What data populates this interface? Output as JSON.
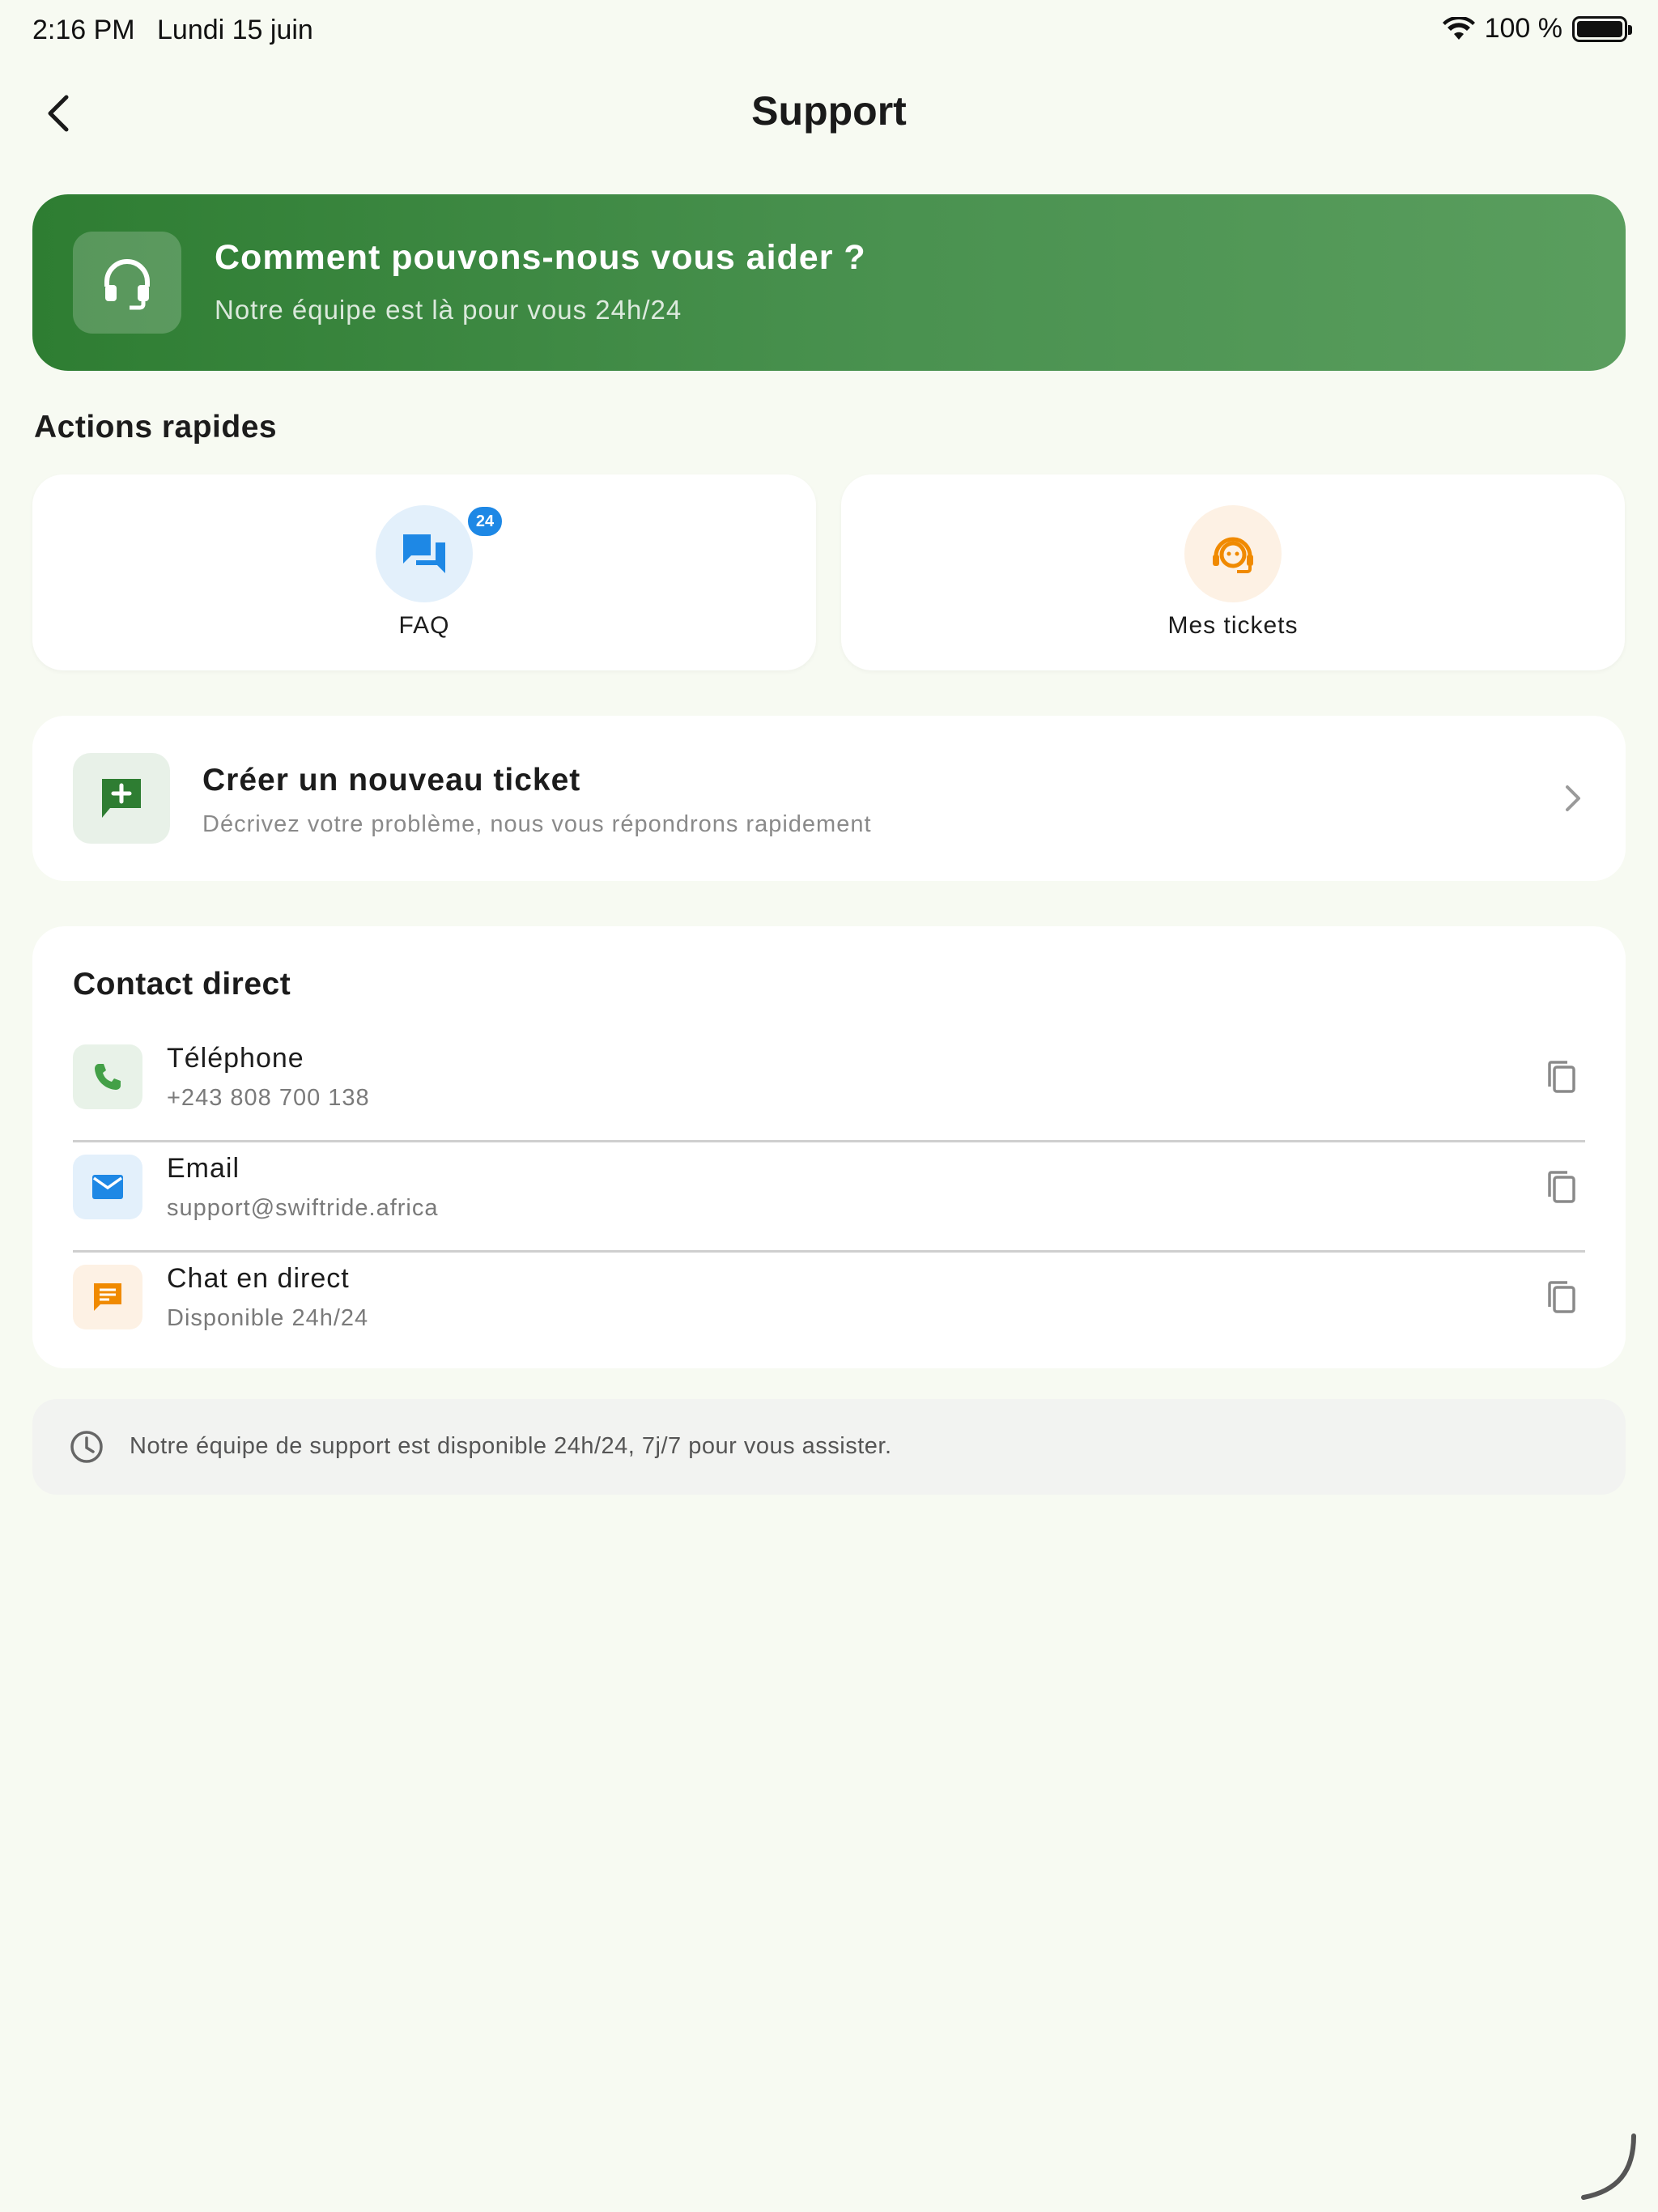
{
  "status_bar": {
    "time": "2:16 PM",
    "date": "Lundi 15 juin",
    "battery": "100 %"
  },
  "nav": {
    "title": "Support"
  },
  "hero": {
    "title": "Comment pouvons-nous vous aider ?",
    "subtitle": "Notre équipe est là pour vous 24h/24"
  },
  "quick_actions": {
    "heading": "Actions rapides",
    "items": [
      {
        "label": "FAQ",
        "badge": "24",
        "icon": "chat-bubbles-icon",
        "color": "#1e88e5",
        "bg": "#e3f0fb"
      },
      {
        "label": "Mes tickets",
        "icon": "support-agent-icon",
        "color": "#f08a00",
        "bg": "#fdf1e4"
      }
    ]
  },
  "new_ticket": {
    "title": "Créer un nouveau ticket",
    "subtitle": "Décrivez votre problème, nous vous répondrons rapidement"
  },
  "contact": {
    "heading": "Contact direct",
    "items": [
      {
        "label": "Téléphone",
        "value": "+243 808 700 138",
        "icon": "phone-icon",
        "color": "#43a047",
        "bg": "#e8f2e8"
      },
      {
        "label": "Email",
        "value": "support@swiftride.africa",
        "icon": "email-icon",
        "color": "#1e88e5",
        "bg": "#e3f0fb"
      },
      {
        "label": "Chat en direct",
        "value": "Disponible 24h/24",
        "icon": "chat-icon",
        "color": "#f08a00",
        "bg": "#fdf1e4"
      }
    ]
  },
  "note": {
    "text": "Notre équipe de support est disponible 24h/24, 7j/7 pour vous assister."
  },
  "colors": {
    "primary": "#2e7d32",
    "background": "#f7faf2",
    "card": "#ffffff"
  }
}
